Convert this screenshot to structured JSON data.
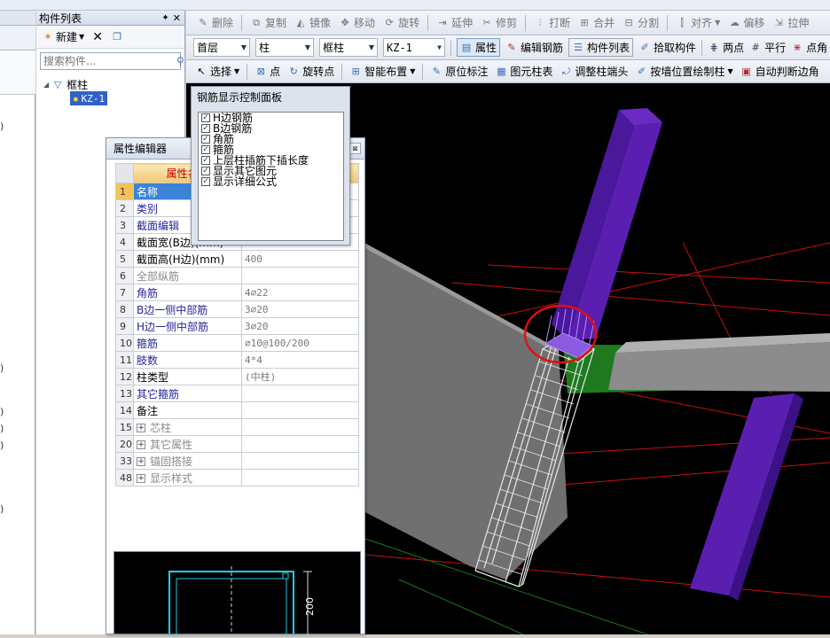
{
  "left_panel": {
    "parens": [
      ")",
      ")",
      ")",
      ")",
      ")",
      ")"
    ]
  },
  "component_list": {
    "title": "构件列表",
    "pin_icon": "pin-icon",
    "new_label": "新建",
    "search_placeholder": "搜索构件...",
    "tree_root": "框柱",
    "tree_child": "KZ-1"
  },
  "toolbar1": {
    "delete": "删除",
    "copy": "复制",
    "mirror": "镜像",
    "move": "移动",
    "rotate": "旋转",
    "extend": "延伸",
    "trim": "修剪",
    "break": "打断",
    "merge": "合并",
    "split": "分割",
    "align": "对齐",
    "offset": "偏移",
    "stretch": "拉伸"
  },
  "toolbar2": {
    "floor": "首层",
    "type": "柱",
    "subtype": "框柱",
    "component": "KZ-1",
    "property": "属性",
    "edit_rebar": "编辑钢筋",
    "component_list": "构件列表",
    "pick_component": "拾取构件",
    "two_points": "两点",
    "parallel": "平行",
    "point_angle": "点角"
  },
  "toolbar3": {
    "select": "选择",
    "point": "点",
    "rotate_point": "旋转点",
    "smart_layout": "智能布置",
    "in_place_label": "原位标注",
    "drawing_column_table": "图元柱表",
    "adjust_column_end": "调整柱端头",
    "draw_by_wall": "按墙位置绘制柱",
    "auto_edge": "自动判断边角"
  },
  "property_editor": {
    "title": "属性编辑器",
    "header_name": "属性名称",
    "rows": [
      {
        "num": "1",
        "name": "名称",
        "value": "",
        "style": "blue"
      },
      {
        "num": "2",
        "name": "类别",
        "value": "",
        "style": "blue"
      },
      {
        "num": "3",
        "name": "截面编辑",
        "value": "",
        "style": "blue"
      },
      {
        "num": "4",
        "name": "截面宽(B边)(mm)",
        "value": "",
        "style": "black"
      },
      {
        "num": "5",
        "name": "截面高(H边)(mm)",
        "value": "400",
        "style": "black"
      },
      {
        "num": "6",
        "name": "全部纵筋",
        "value": "",
        "style": "gray"
      },
      {
        "num": "7",
        "name": "角筋",
        "value": "4⌀22",
        "style": "blue"
      },
      {
        "num": "8",
        "name": "B边一侧中部筋",
        "value": "3⌀20",
        "style": "blue"
      },
      {
        "num": "9",
        "name": "H边一侧中部筋",
        "value": "3⌀20",
        "style": "blue"
      },
      {
        "num": "10",
        "name": "箍筋",
        "value": "⌀10@100/200",
        "style": "blue"
      },
      {
        "num": "11",
        "name": "肢数",
        "value": "4*4",
        "style": "blue"
      },
      {
        "num": "12",
        "name": "柱类型",
        "value": "(中柱)",
        "style": "black"
      },
      {
        "num": "13",
        "name": "其它箍筋",
        "value": "",
        "style": "blue"
      },
      {
        "num": "14",
        "name": "备注",
        "value": "",
        "style": "black"
      },
      {
        "num": "15",
        "name": "芯柱",
        "value": "",
        "style": "gray",
        "group": true
      },
      {
        "num": "20",
        "name": "其它属性",
        "value": "",
        "style": "gray",
        "group": true
      },
      {
        "num": "33",
        "name": "锚固搭接",
        "value": "",
        "style": "gray",
        "group": true
      },
      {
        "num": "48",
        "name": "显示样式",
        "value": "",
        "style": "gray",
        "group": true
      }
    ]
  },
  "section_preview": {
    "dimension": "200"
  },
  "rebar_panel": {
    "title": "钢筋显示控制面板",
    "items": [
      {
        "label": "H边钢筋",
        "checked": true
      },
      {
        "label": "B边钢筋",
        "checked": true
      },
      {
        "label": "角筋",
        "checked": true
      },
      {
        "label": "箍筋",
        "checked": true
      },
      {
        "label": "上层柱插筋下插长度",
        "checked": true
      },
      {
        "label": "显示其它图元",
        "checked": true
      },
      {
        "label": "显示详细公式",
        "checked": true
      }
    ]
  },
  "colors": {
    "column_purple": "#5a1fb0",
    "beam_gray": "#8a8a8a",
    "slab_green": "#1f7a1f",
    "grid_red": "#c81010",
    "highlight_circle": "#e01010",
    "selection_blue": "#3161c5"
  }
}
